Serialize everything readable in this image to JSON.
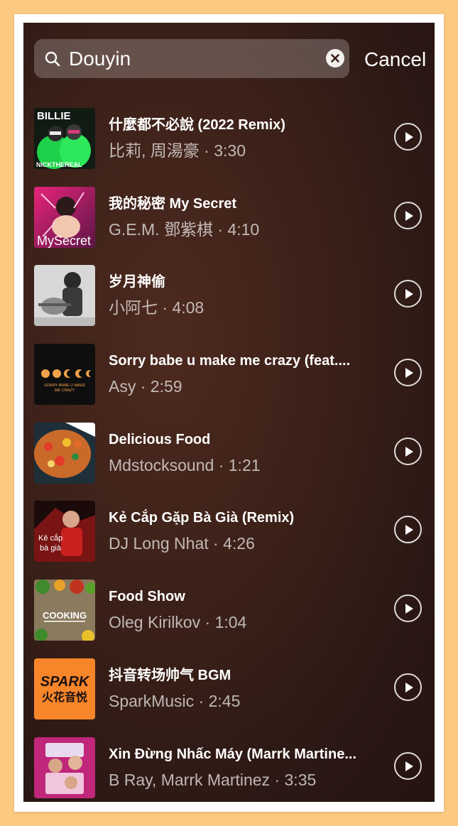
{
  "search": {
    "query": "Douyin",
    "cancel_label": "Cancel"
  },
  "tracks": [
    {
      "title": "什麼都不必說 (2022 Remix)",
      "artist": "比莉, 周湯豪",
      "duration": "3:30",
      "art_text": "BILLIE / NICKTHEREAL"
    },
    {
      "title": "我的秘密 My Secret",
      "artist": "G.E.M. 鄧紫棋",
      "duration": "4:10",
      "art_text": "MySecret"
    },
    {
      "title": "岁月神偷",
      "artist": "小阿七",
      "duration": "4:08",
      "art_text": ""
    },
    {
      "title": "Sorry babe u make me crazy (feat....",
      "artist": "Asy",
      "duration": "2:59",
      "art_text": "SORRY BABE U MAKE ME CRAZY"
    },
    {
      "title": "Delicious Food",
      "artist": "Mdstocksound",
      "duration": "1:21",
      "art_text": ""
    },
    {
      "title": "Kẻ Cắp Gặp Bà Già (Remix)",
      "artist": "DJ Long Nhat",
      "duration": "4:26",
      "art_text": "Kẻ cắp bà già"
    },
    {
      "title": "Food Show",
      "artist": "Oleg Kirilkov",
      "duration": "1:04",
      "art_text": "COOKING"
    },
    {
      "title": "抖音转场帅气 BGM",
      "artist": "SparkMusic",
      "duration": "2:45",
      "art_text": "SPARK 火花音悦"
    },
    {
      "title": "Xin Đừng Nhấc Máy (Marrk Martine...",
      "artist": "B Ray, Marrk Martinez",
      "duration": "3:35",
      "art_text": ""
    }
  ]
}
